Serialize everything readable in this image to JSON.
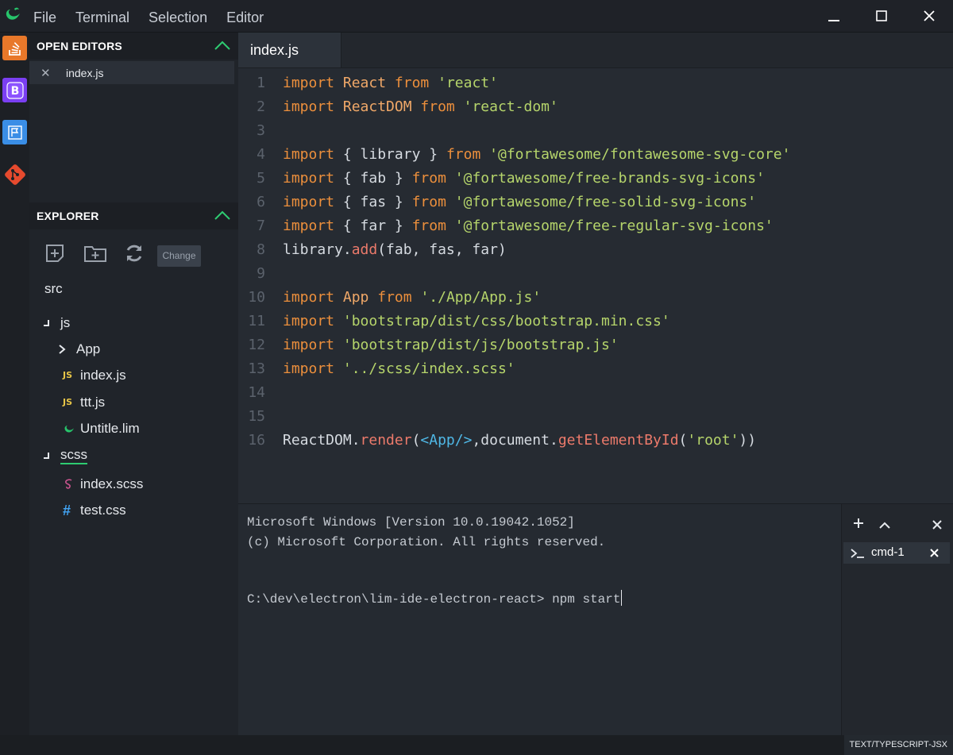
{
  "menu": [
    "File",
    "Terminal",
    "Selection",
    "Editor"
  ],
  "open_editors": {
    "title": "OPEN EDITORS",
    "items": [
      {
        "name": "index.js"
      }
    ]
  },
  "explorer": {
    "title": "EXPLORER",
    "change_label": "Change",
    "root": "src",
    "tree": {
      "js": "js",
      "app": "App",
      "index_js": "index.js",
      "ttt_js": "ttt.js",
      "untitle_lim": "Untitle.lim",
      "scss": "scss",
      "index_scss": "index.scss",
      "test_css": "test.css"
    }
  },
  "editor": {
    "tab": "index.js",
    "line_numbers": [
      "1",
      "2",
      "3",
      "4",
      "5",
      "6",
      "7",
      "8",
      "9",
      "10",
      "11",
      "12",
      "13",
      "14",
      "15",
      "16"
    ]
  },
  "terminal": {
    "lines": [
      "Microsoft Windows [Version 10.0.19042.1052]",
      "(c) Microsoft Corporation. All rights reserved.",
      "C:\\dev\\electron\\lim-ide-electron-react> npm start"
    ],
    "session": "cmd-1"
  },
  "status": {
    "language": "TEXT/TYPESCRIPT-JSX"
  },
  "colors": {
    "accent_green": "#2ecc71",
    "keyword": "#ec8f3c",
    "string": "#b6d56b",
    "function": "#ec7a6b",
    "jsx": "#4fb8e6"
  }
}
